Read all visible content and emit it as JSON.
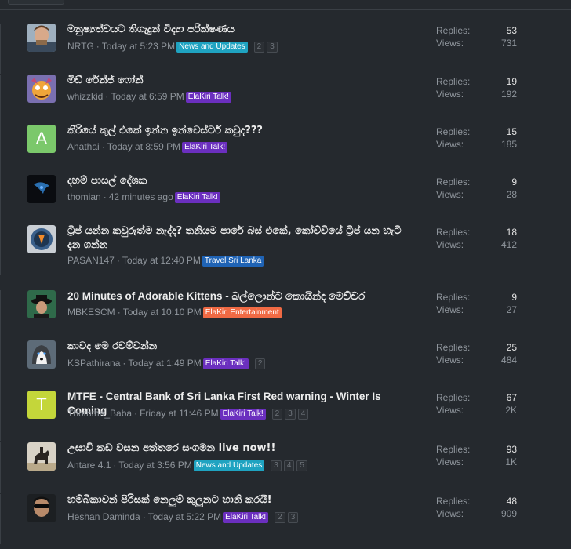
{
  "colors": {
    "background": "#25292e",
    "tag_news": "#1fa3c1",
    "tag_elakiri": "#6b2fbf",
    "tag_travel": "#1f63b5",
    "tag_entertainment": "#f06a44"
  },
  "labels": {
    "replies": "Replies:",
    "views": "Views:"
  },
  "threads": [
    {
      "title": "මනුෂ්‍යත්වයට තිගැදුන් විද්‍යා පරීක්ෂණය",
      "author": "NRTG",
      "time": "Today at 5:23 PM",
      "tag": "News and Updates",
      "tag_color": "#1fa3c1",
      "pages": [
        "2",
        "3"
      ],
      "replies": "53",
      "views": "731",
      "avatar": "photo-man"
    },
    {
      "title": "මිඩ් රේන්ජ් ෆෝන්",
      "author": "whizzkid",
      "time": "Today at 6:59 PM",
      "tag": "ElaKiri Talk!",
      "tag_color": "#6b2fbf",
      "pages": [],
      "replies": "19",
      "views": "192",
      "avatar": "photo-cartoon"
    },
    {
      "title": "කිරියේ කුල් එකේ ඉන්න ඉන්වෙස්ටර් කවුද???",
      "author": "Anathai",
      "time": "Today at 8:59 PM",
      "tag": "ElaKiri Talk!",
      "tag_color": "#6b2fbf",
      "pages": [],
      "replies": "15",
      "views": "185",
      "avatar": "letter",
      "letter": "A",
      "letter_bg": "#7bc86b"
    },
    {
      "title": "දහම් පාසල් දේශක",
      "author": "thomian",
      "time": "42 minutes ago",
      "tag": "ElaKiri Talk!",
      "tag_color": "#6b2fbf",
      "pages": [],
      "replies": "9",
      "views": "28",
      "avatar": "photo-dark"
    },
    {
      "title": "ට්‍රිප් යන්න කවුරුත්ම නැද්ද? තනියම පාරේ බස් එකේ, කෝච්චියේ ට්‍රිප් යන හැටි දැන ගන්න",
      "author": "PASAN147",
      "time": "Today at 12:40 PM",
      "tag": "Travel Sri Lanka",
      "tag_color": "#1f63b5",
      "pages": [],
      "replies": "18",
      "views": "412",
      "avatar": "photo-badge"
    },
    {
      "title": "20 Minutes of Adorable Kittens - බල්ලොන්ට කොයින්ද මෙච්චර",
      "author": "MBKESCM",
      "time": "Today at 10:10 PM",
      "tag": "ElaKiri Entertainment",
      "tag_color": "#f06a44",
      "pages": [],
      "replies": "9",
      "views": "27",
      "avatar": "photo-hat"
    },
    {
      "title": "කාවද මෙ රවම්වන්න",
      "author": "KSPathirana",
      "time": "Today at 1:49 PM",
      "tag": "ElaKiri Talk!",
      "tag_color": "#6b2fbf",
      "pages": [
        "2"
      ],
      "replies": "25",
      "views": "484",
      "avatar": "photo-husky"
    },
    {
      "title": "MTFE - Central Bank of Sri Lanka First Red warning - Winter Is Coming",
      "author": "Thoththa_Baba",
      "time": "Friday at 11:46 PM",
      "tag": "ElaKiri Talk!",
      "tag_color": "#6b2fbf",
      "pages": [
        "2",
        "3",
        "4"
      ],
      "replies": "67",
      "views": "2K",
      "avatar": "letter",
      "letter": "T",
      "letter_bg": "#c4d63a"
    },
    {
      "title": "උසාවි කඩ වසන අත්තරෙ සංගමන live now!!",
      "author": "Antare 4.1",
      "time": "Today at 3:56 PM",
      "tag": "News and Updates",
      "tag_color": "#1fa3c1",
      "pages": [
        "3",
        "4",
        "5"
      ],
      "replies": "93",
      "views": "1K",
      "avatar": "photo-horse"
    },
    {
      "title": "හම්බිකාවන් පිරිසක් නෙලුම් කුලුනට හානි කරයි!",
      "author": "Heshan Daminda",
      "time": "Today at 5:22 PM",
      "tag": "ElaKiri Talk!",
      "tag_color": "#6b2fbf",
      "pages": [
        "2",
        "3"
      ],
      "replies": "48",
      "views": "909",
      "avatar": "photo-shades"
    }
  ]
}
